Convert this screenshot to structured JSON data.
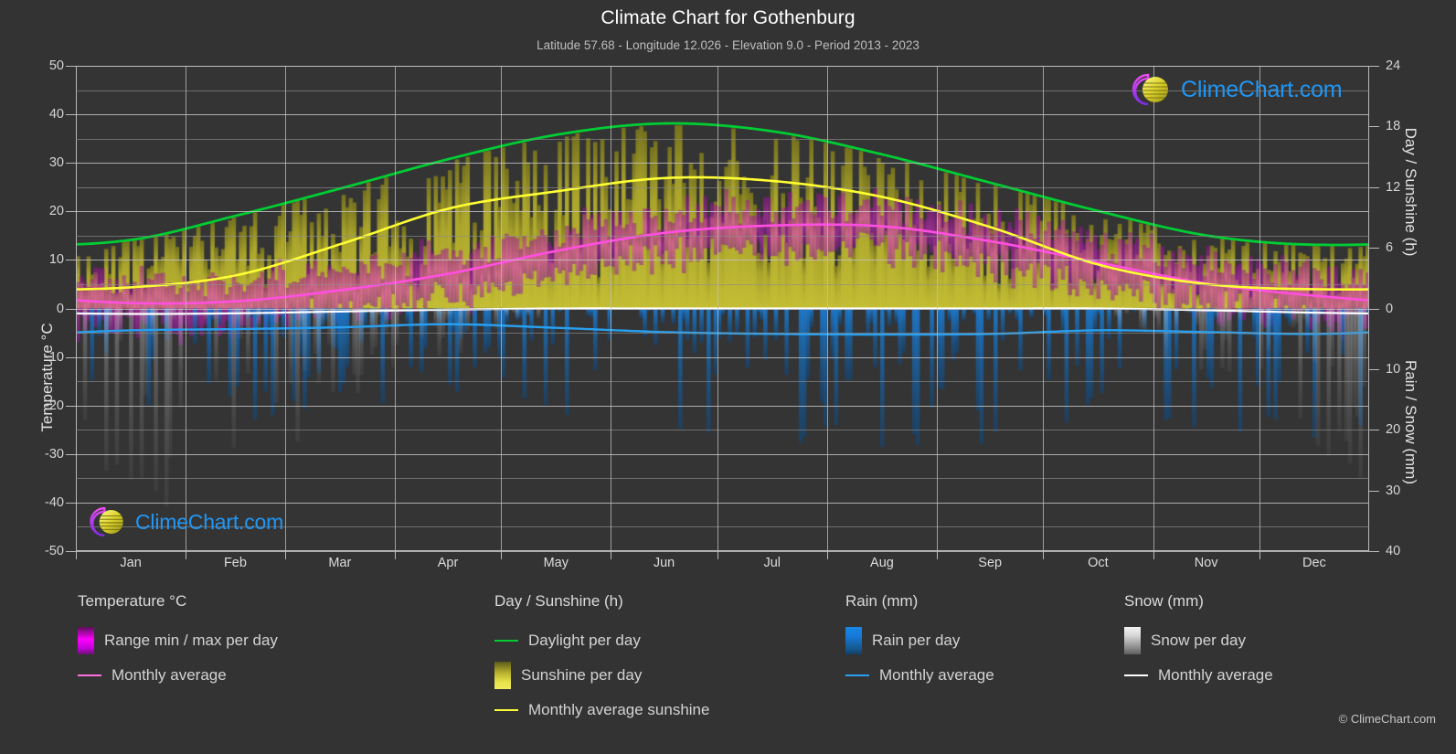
{
  "header": {
    "title": "Climate Chart for Gothenburg",
    "subtitle": "Latitude 57.68 - Longitude 12.026 - Elevation 9.0 - Period 2013 - 2023"
  },
  "axes": {
    "left_label": "Temperature °C",
    "right_label_top": "Day / Sunshine (h)",
    "right_label_bottom": "Rain / Snow (mm)",
    "left_ticks": [
      "50",
      "40",
      "30",
      "20",
      "10",
      "0",
      "-10",
      "-20",
      "-30",
      "-40",
      "-50"
    ],
    "right_ticks": [
      "24",
      "18",
      "12",
      "6",
      "0",
      "10",
      "20",
      "30",
      "40"
    ],
    "x_ticks": [
      "Jan",
      "Feb",
      "Mar",
      "Apr",
      "May",
      "Jun",
      "Jul",
      "Aug",
      "Sep",
      "Oct",
      "Nov",
      "Dec"
    ]
  },
  "legend": {
    "temperature": {
      "title": "Temperature °C",
      "items": [
        {
          "label": "Range min / max per day",
          "type": "box",
          "color": "#ff00ff"
        },
        {
          "label": "Monthly average",
          "type": "line",
          "color": "#ff6fe0"
        }
      ]
    },
    "sunshine": {
      "title": "Day / Sunshine (h)",
      "items": [
        {
          "label": "Daylight per day",
          "type": "line",
          "color": "#00cc33"
        },
        {
          "label": "Sunshine per day",
          "type": "box",
          "color": "#e8e34a"
        },
        {
          "label": "Monthly average sunshine",
          "type": "line",
          "color": "#ffff33"
        }
      ]
    },
    "rain": {
      "title": "Rain (mm)",
      "items": [
        {
          "label": "Rain per day",
          "type": "box",
          "color": "#1787e8"
        },
        {
          "label": "Monthly average",
          "type": "line",
          "color": "#29a0ef"
        }
      ]
    },
    "snow": {
      "title": "Snow (mm)",
      "items": [
        {
          "label": "Snow per day",
          "type": "box",
          "color": "#d9d9d9"
        },
        {
          "label": "Monthly average",
          "type": "line",
          "color": "#ffffff"
        }
      ]
    }
  },
  "watermark": {
    "text": "ClimeChart.com",
    "crescent_color": "#cc22cc",
    "sphere_color": "#e6dd33",
    "text_color": "#2196f3"
  },
  "copyright": "© ClimeChart.com",
  "colors": {
    "background": "#333333",
    "plot_background": "#343434",
    "grid": "#8e8e8e",
    "axis": "#b9b9b9",
    "text": "#d9d9d9",
    "daylight": "#00cc33",
    "sunshine_avg": "#ffff33",
    "sunshine_fill": "#b5b02c",
    "temp_avg": "#ff4fe0",
    "temp_fill": "#c0309e",
    "rain_avg": "#29a0ef",
    "rain_fill": "#1a6fae",
    "snow_avg": "#ffffff",
    "snow_fill": "#9a9a9a"
  },
  "chart_data": {
    "type": "line",
    "title": "Climate Chart for Gothenburg",
    "subtitle": "Latitude 57.68 - Longitude 12.026 - Elevation 9.0 - Period 2013 - 2023",
    "xlabel": "",
    "ylabel": "Temperature °C",
    "ylabel_right_top": "Day / Sunshine (h)",
    "ylabel_right_bottom": "Rain / Snow (mm)",
    "ylim": [
      -50,
      50
    ],
    "ylim_right_sunshine": [
      0,
      24
    ],
    "ylim_right_precip": [
      0,
      40
    ],
    "grid": true,
    "legend_position": "below",
    "categories": [
      "Jan",
      "Feb",
      "Mar",
      "Apr",
      "May",
      "Jun",
      "Jul",
      "Aug",
      "Sep",
      "Oct",
      "Nov",
      "Dec"
    ],
    "series": [
      {
        "name": "Daylight per day",
        "unit": "h",
        "axis": "right-sunshine",
        "color": "#00cc33",
        "values": [
          6.8,
          9.2,
          11.9,
          14.8,
          17.2,
          18.3,
          17.5,
          15.2,
          12.4,
          9.6,
          7.2,
          6.3
        ]
      },
      {
        "name": "Monthly average sunshine",
        "unit": "h",
        "axis": "right-sunshine",
        "color": "#ffff33",
        "values": [
          2.1,
          3.3,
          6.4,
          9.9,
          11.6,
          12.9,
          12.6,
          11.0,
          8.0,
          4.3,
          2.4,
          1.9
        ]
      },
      {
        "name": "Monthly average temperature",
        "unit": "°C",
        "axis": "left",
        "color": "#ff4fe0",
        "values": [
          1.1,
          1.5,
          3.8,
          7.2,
          11.9,
          15.6,
          17.1,
          16.9,
          13.8,
          9.4,
          5.1,
          2.6
        ]
      },
      {
        "name": "Rain monthly average",
        "unit": "mm",
        "axis": "right-precip",
        "color": "#29a0ef",
        "values": [
          3.6,
          3.4,
          3.1,
          2.6,
          3.2,
          3.9,
          4.2,
          4.3,
          4.2,
          3.6,
          3.9,
          4.2
        ]
      },
      {
        "name": "Snow monthly average",
        "unit": "mm",
        "axis": "right-precip",
        "color": "#ffffff",
        "values": [
          0.9,
          0.8,
          0.5,
          0.2,
          0.0,
          0.0,
          0.0,
          0.0,
          0.0,
          0.0,
          0.3,
          0.7
        ]
      }
    ],
    "daily_bands": [
      {
        "name": "Range min / max per day",
        "color": "#ff00ff",
        "axis": "left",
        "description": "Daily temperature min/max vertical bars"
      },
      {
        "name": "Sunshine per day",
        "color": "#e8e34a",
        "axis": "right-sunshine",
        "description": "Daily sunshine hours vertical bars"
      },
      {
        "name": "Rain per day",
        "color": "#1787e8",
        "axis": "right-precip",
        "description": "Daily rainfall vertical bars"
      },
      {
        "name": "Snow per day",
        "color": "#d9d9d9",
        "axis": "right-precip",
        "description": "Daily snowfall vertical bars"
      }
    ]
  }
}
